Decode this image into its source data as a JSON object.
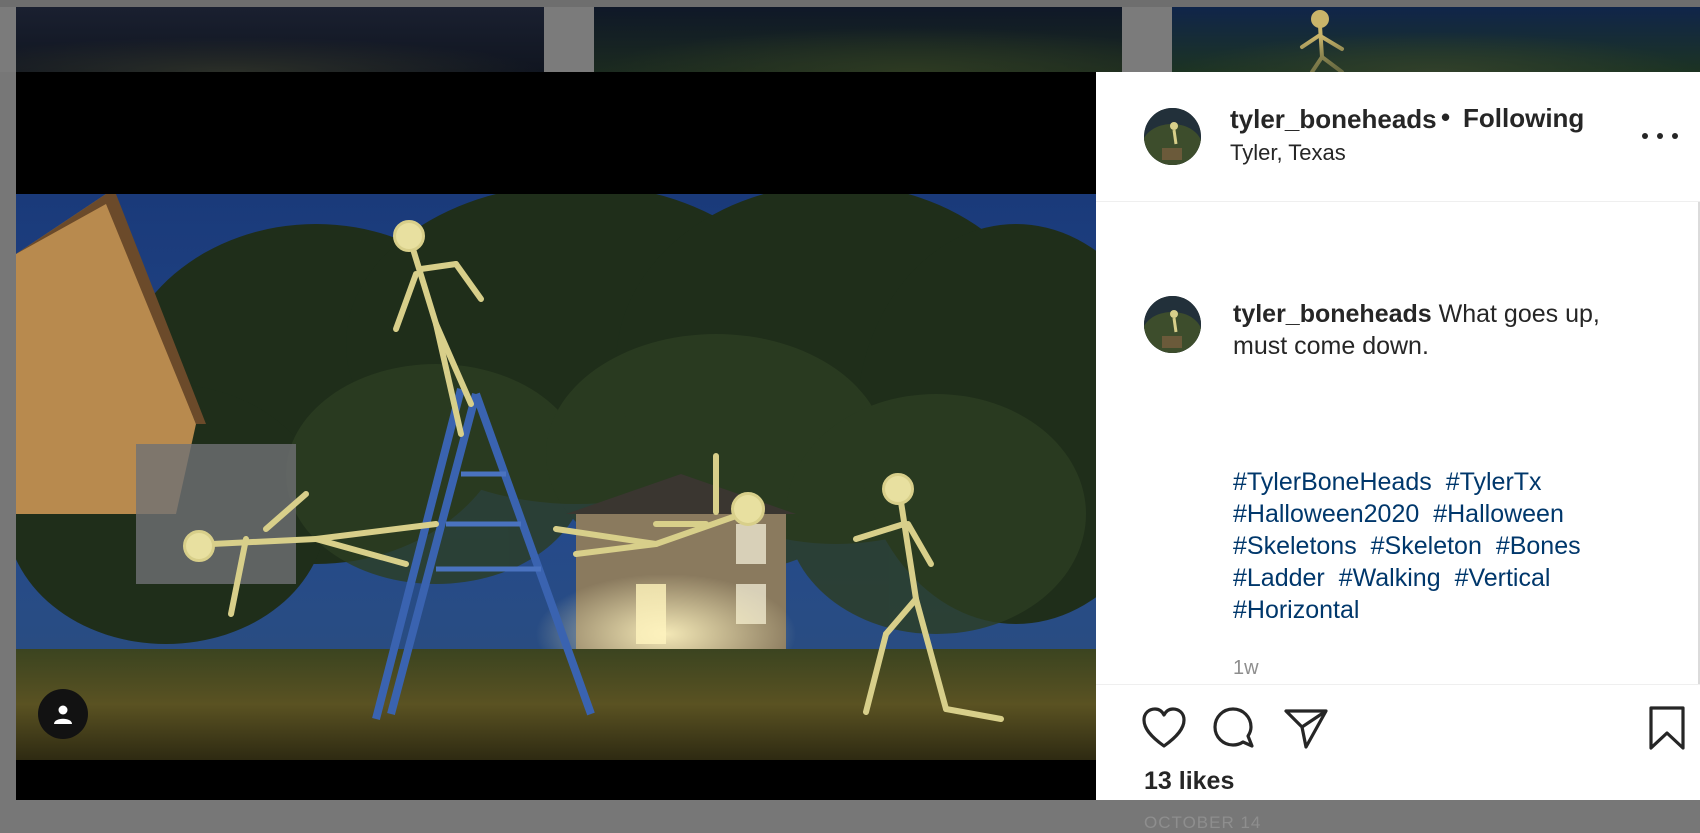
{
  "post": {
    "username": "tyler_boneheads",
    "follow_separator": "•",
    "follow_status": "Following",
    "location": "Tyler, Texas",
    "caption_text": "What goes up, must come down.",
    "hashtags": [
      "#TylerBoneHeads",
      "#TylerTx",
      "#Halloween2020",
      "#Halloween",
      "#Skeletons",
      "#Skeleton",
      "#Bones",
      "#Ladder",
      "#Walking",
      "#Vertical",
      "#Horizontal"
    ],
    "time_ago": "1w",
    "likes": "13 likes",
    "date": "OCTOBER 14"
  },
  "icons": {
    "more": "more-options-icon",
    "like": "heart-icon",
    "comment": "comment-icon",
    "share": "share-icon",
    "save": "bookmark-icon",
    "tags": "user-tag-icon"
  },
  "colors": {
    "text": "#262626",
    "link": "#00376b",
    "muted": "#8e8e8e",
    "media_bg": "#000000"
  }
}
